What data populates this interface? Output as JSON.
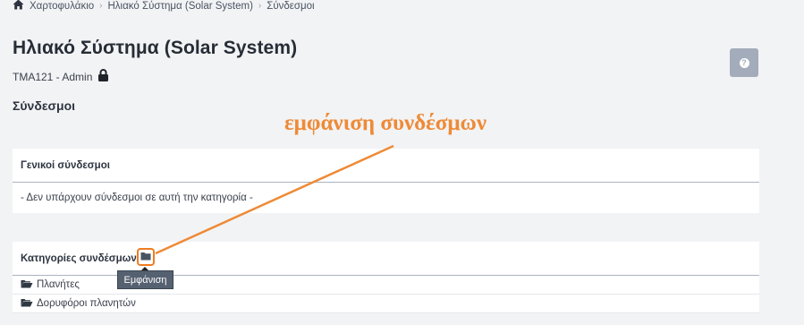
{
  "breadcrumb": {
    "items": [
      "Χαρτοφυλάκιο",
      "Ηλιακό Σύστημα (Solar System)",
      "Σύνδεσμοι"
    ],
    "icon": "home-icon"
  },
  "page": {
    "title": "Ηλιακό Σύστημα (Solar System)",
    "subtitle": "TMA121 - Admin",
    "subtitle_icon": "lock-icon",
    "help_icon": "help-icon"
  },
  "links": {
    "heading": "Σύνδεσμοι",
    "general_title": "Γενικοί σύνδεσμοι",
    "general_empty": "- Δεν υπάρχουν σύνδεσμοι σε αυτή την κατηγορία -",
    "categories_title": "Κατηγορίες συνδέσμων",
    "categories": [
      "Πλανήτες",
      "Δορυφόροι πλανητών"
    ]
  },
  "tooltip": {
    "text": "Εμφάνιση"
  },
  "annotation": {
    "text": "εμφάνιση συνδέσμων"
  },
  "colors": {
    "accent": "#ee8a36",
    "background": "#f2f3f5",
    "help_button": "#a3acba",
    "tooltip_bg": "#556070"
  }
}
